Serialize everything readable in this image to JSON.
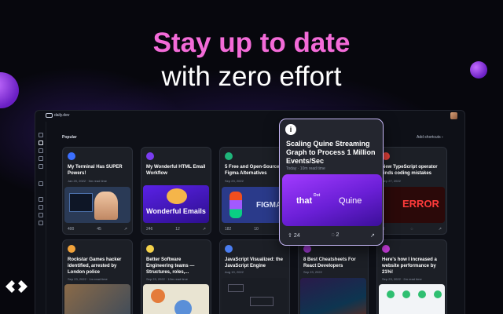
{
  "headline": {
    "line1": "Stay up to date",
    "line2": "with zero effort"
  },
  "app": {
    "logo_text": "daily.dev",
    "section_title": "Popular",
    "add_shortcuts": "Add shortcuts"
  },
  "hover_card": {
    "source_icon": "i",
    "title": "Scaling Quine Streaming Graph to Process 1 Million Events/Sec",
    "meta": "Today · 10m read time",
    "image_text_that": "that",
    "image_text_dot": "Dot",
    "image_text_quine": "Quine",
    "upvotes": "24",
    "comments": "2"
  },
  "cards_row1": [
    {
      "title": "My Terminal Has SUPER Powers!",
      "meta": "Jan 20, 2022 · 5m read time",
      "upvotes": "400",
      "comments": "45",
      "img_text": ""
    },
    {
      "title": "My Wonderful HTML Email Workflow",
      "meta": "",
      "upvotes": "246",
      "comments": "12",
      "img_text": "Wonderful Emails"
    },
    {
      "title": "5 Free and Open-Source Figma Alternatives",
      "meta": "Sep 23, 2022",
      "upvotes": "182",
      "comments": "10",
      "img_text": "FIGMA"
    },
    {
      "title": "New TypeScript operator finds coding mistakes",
      "meta": "Sep 27, 2022",
      "upvotes": "",
      "comments": "",
      "img_text": "ERROR"
    }
  ],
  "cards_row2": [
    {
      "title": "Rockstar Games hacker identified, arrested by London police",
      "meta": "Sep 23, 2022 · 1m read time"
    },
    {
      "title": "Better Software Engineering teams — Structures, roles,...",
      "meta": "Sep 23, 2022 · 10m read time"
    },
    {
      "title": "JavaScript Visualized: the JavaScript Engine",
      "meta": "Aug 19, 2022"
    },
    {
      "title": "8 Best Cheatsheets For React Developers",
      "meta": "Sep 23, 2022"
    },
    {
      "title": "Here's how I increased a website performance by 21%!",
      "meta": "Sep 23, 2022 · 2m read time"
    }
  ],
  "colors": {
    "accent_pink": "#f36bd8",
    "card_bg": "#1c1f26",
    "hover_border": "#c4b5f4",
    "purple": "#7b2cf0"
  }
}
